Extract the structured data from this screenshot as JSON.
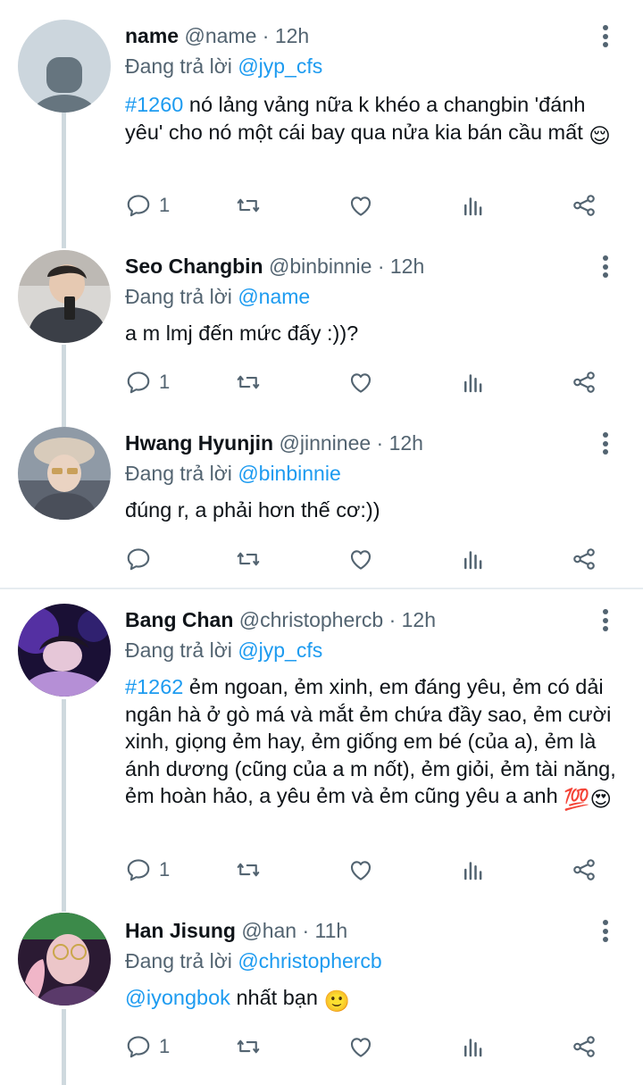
{
  "reply_prefix": "Đang trả lời",
  "tweets": [
    {
      "display_name": "name",
      "handle": "@name",
      "time": "· 12h",
      "reply_to": "@jyp_cfs",
      "hashtag": "#1260",
      "text": " nó lảng vảng nữa  k khéo a changbin 'đánh yêu' cho nó một cái bay qua nửa kia bán cầu mất ",
      "emoji": "😌",
      "reply_count": "1"
    },
    {
      "display_name": "Seo Changbin",
      "handle": "@binbinnie",
      "time": "· 12h",
      "reply_to": "@name",
      "text": "a m lmj đến mức đấy :))?",
      "reply_count": "1"
    },
    {
      "display_name": "Hwang Hyunjin",
      "handle": "@jinninee",
      "time": "· 12h",
      "reply_to": "@binbinnie",
      "text": "đúng r, a phải hơn thế cơ:))",
      "reply_count": ""
    },
    {
      "display_name": "Bang Chan",
      "handle": "@christophercb",
      "time": "· 12h",
      "reply_to": "@jyp_cfs",
      "hashtag": "#1262",
      "text": " ẻm ngoan, ẻm xinh, em đáng yêu, ẻm có dải ngân hà ở gò má và mắt ẻm chứa đầy sao, ẻm cười xinh, giọng ẻm hay, ẻm giống em bé (của a), ẻm là ánh dương (cũng của a m nốt), ẻm giỏi, ẻm tài năng, ẻm hoàn hảo, a yêu ẻm  và ẻm cũng yêu a anh ",
      "emoji": "💯😍",
      "reply_count": "1"
    },
    {
      "display_name": "Han Jisung",
      "handle": "@han",
      "time": "· 11h",
      "reply_to": "@christophercb",
      "mention": "@iyongbok",
      "text": " nhất bạn ",
      "emoji": "🙂",
      "reply_count": "1"
    }
  ],
  "icons": [
    "reply-icon",
    "retweet-icon",
    "like-icon",
    "analytics-icon",
    "share-icon",
    "more-icon"
  ],
  "colors": {
    "link": "#1d9bf0",
    "muted": "#536471",
    "text": "#0f1419",
    "thread_line": "#cfd9de"
  }
}
